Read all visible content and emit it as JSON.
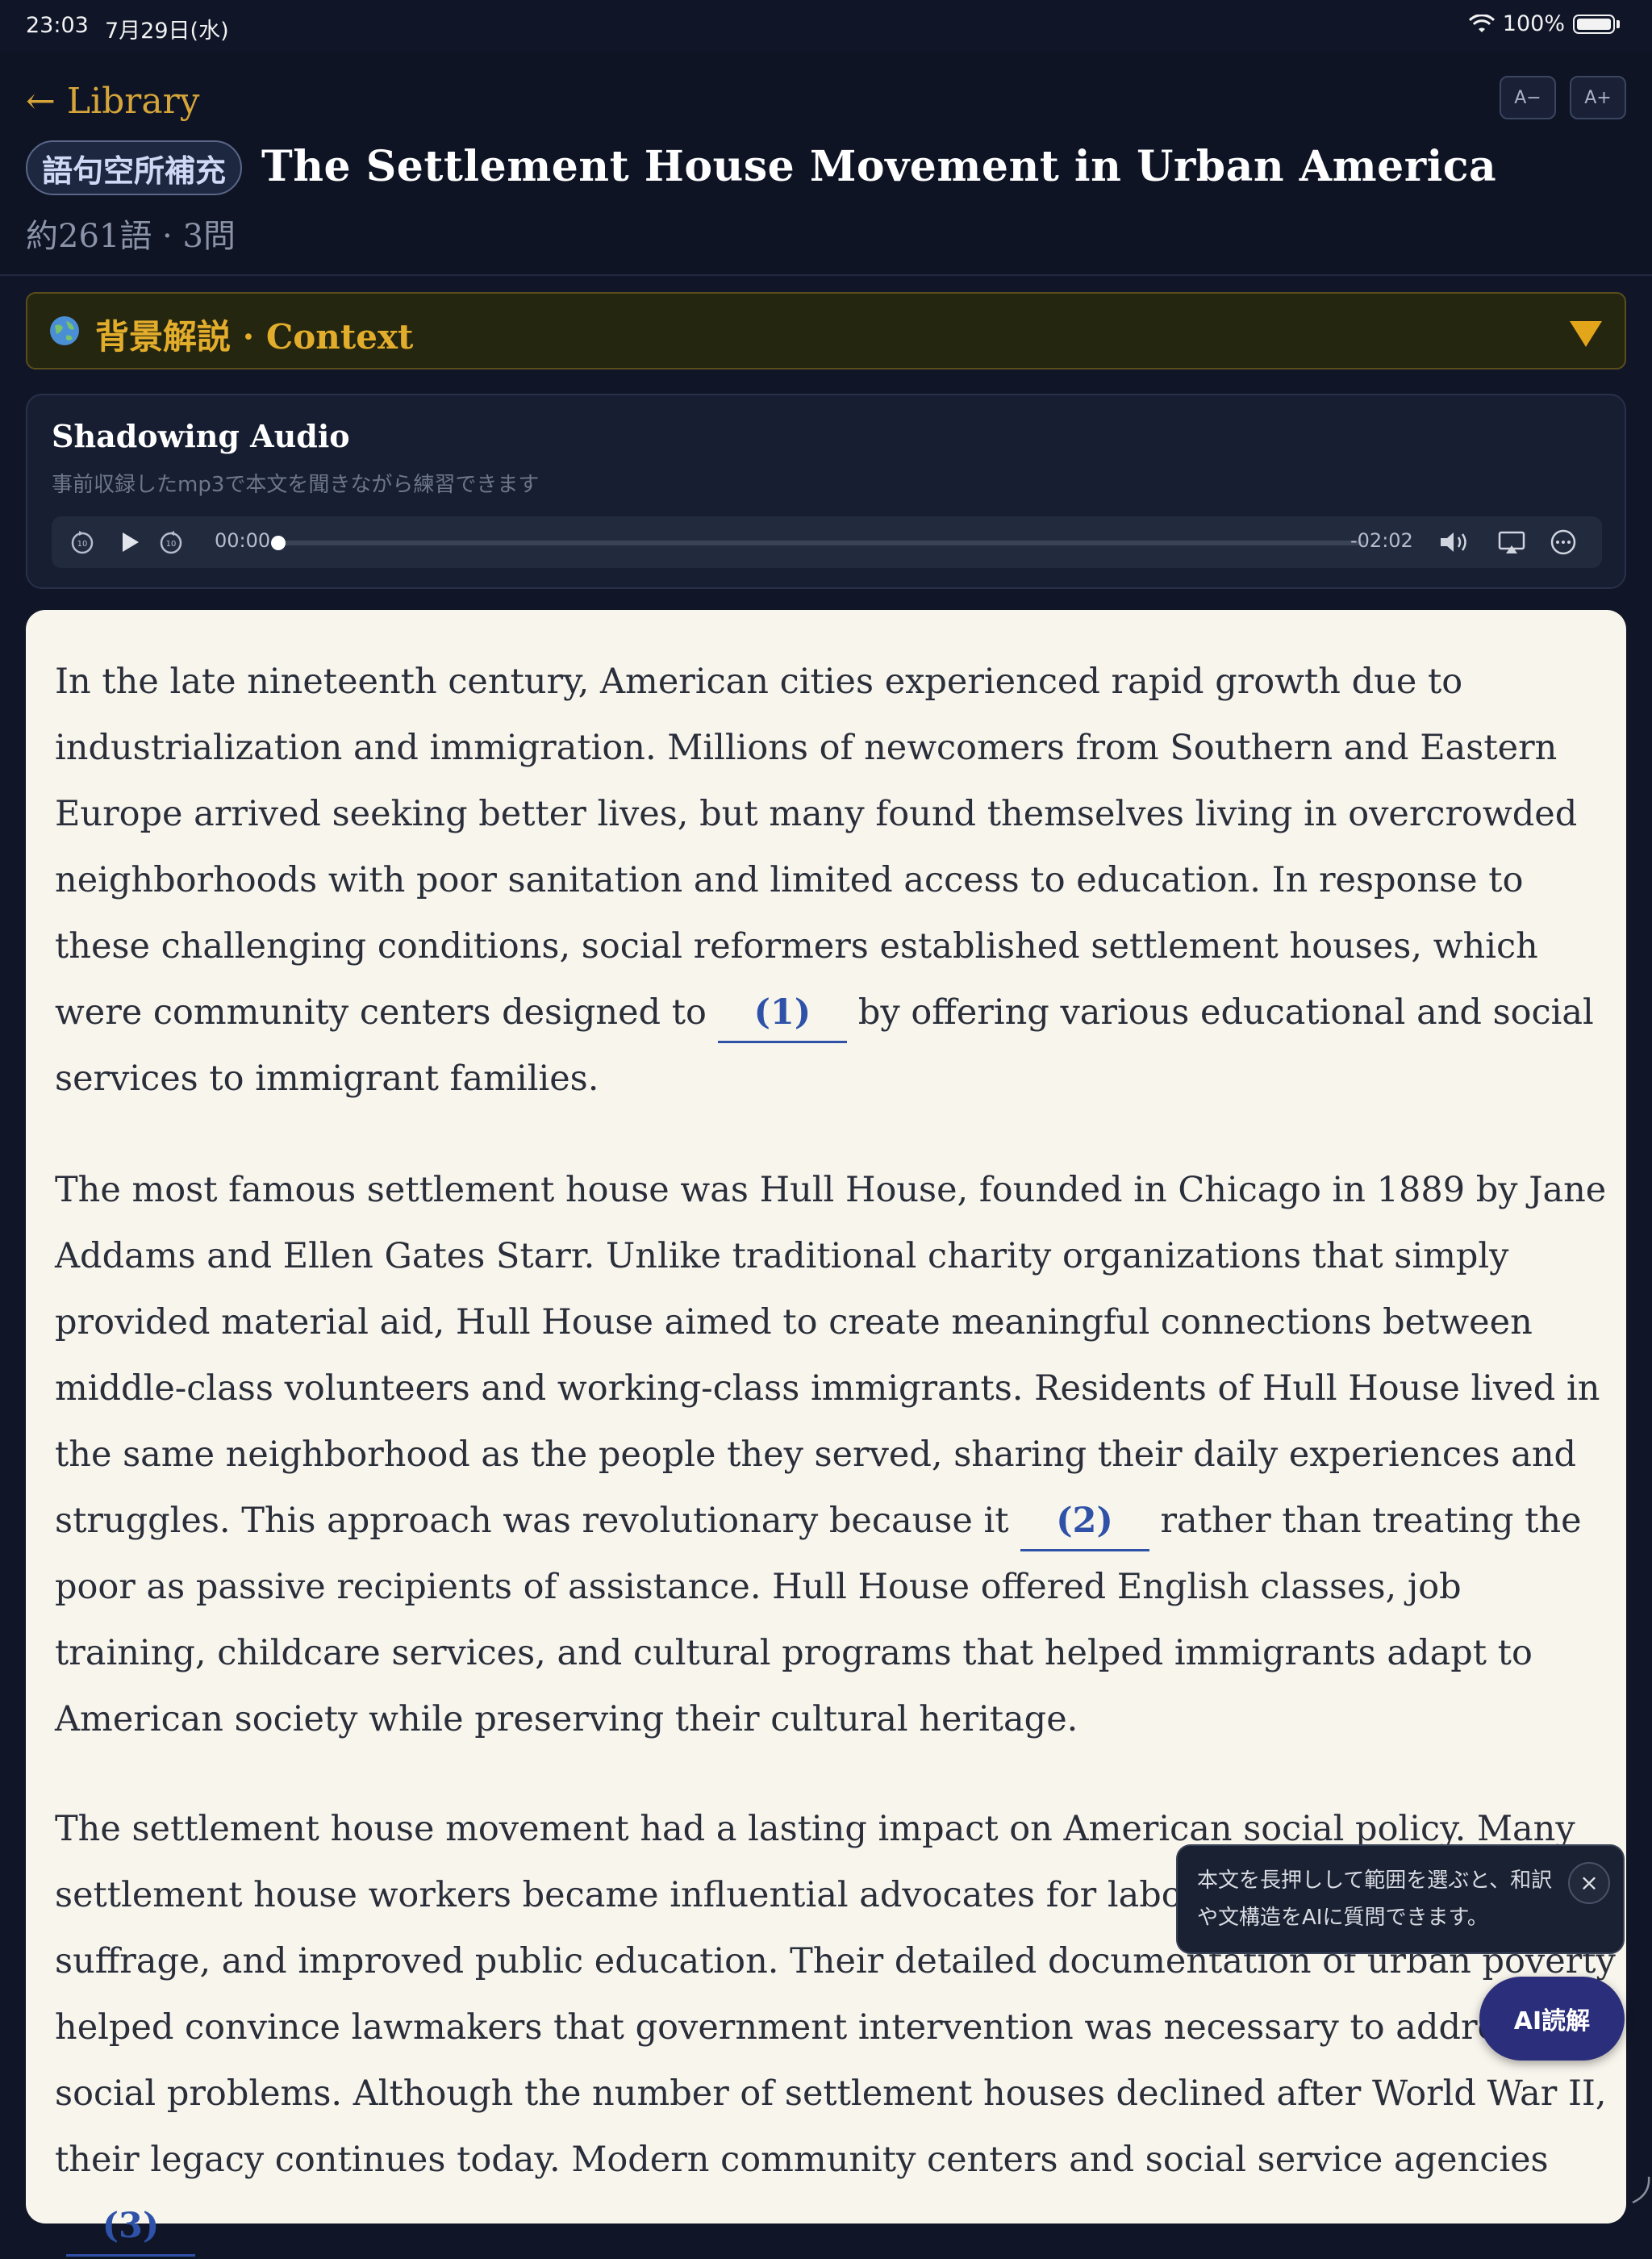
{
  "status": {
    "time": "23:03",
    "date": "7月29日(水)",
    "battery": "100%"
  },
  "header": {
    "back_label": "← Library",
    "font_decrease": "A−",
    "font_increase": "A+",
    "tag": "語句空所補充",
    "title": "The Settlement House Movement in Urban America",
    "meta": "約261語 · 3問"
  },
  "context": {
    "label": "背景解説 · Context"
  },
  "audio": {
    "title": "Shadowing Audio",
    "subtitle": "事前収録したmp3で本文を聞きながら練習できます",
    "current_time": "00:00",
    "remaining_time": "-02:02",
    "progress": 0
  },
  "passage": {
    "p1_a": "In the late nineteenth century, American cities experienced rapid growth due to industrialization and immigration. Millions of newcomers from Southern and Eastern Europe arrived seeking better lives, but many found themselves living in overcrowded neighborhoods with poor sanitation and limited access to education. In response to these challenging conditions, social reformers established settlement houses, which were community centers designed to",
    "blank1": "(1)",
    "p1_b": "by offering various educational and social services to immigrant families.",
    "p2_a": "The most famous settlement house was Hull House, founded in Chicago in 1889 by Jane Addams and Ellen Gates Starr. Unlike traditional charity organizations that simply provided material aid, Hull House aimed to create meaningful connections between middle-class volunteers and working-class immigrants. Residents of Hull House lived in the same neighborhood as the people they served, sharing their daily experiences and struggles. This approach was revolutionary because it",
    "blank2": "(2)",
    "p2_b": "rather than treating the poor as passive recipients of assistance. Hull House offered English classes, job training, childcare services, and cultural programs that helped immigrants adapt to American society while preserving their cultural heritage.",
    "p3_a": "The settlement house movement had a lasting impact on American social policy. Many settlement house workers became influential advocates for labor reform, women's suffrage, and improved public education. Their detailed documentation of urban poverty helped convince lawmakers that government intervention was necessary to address social problems. Although the number of settlement houses declined after World War II, their legacy continues today. Modern community centers and social service agencies",
    "blank3": "(3)"
  },
  "tooltip": {
    "text": "本文を長押しして範囲を選ぶと、和訳や文構造をAIに質問できます。",
    "close": "×"
  },
  "ai_button": {
    "label": "AI読解"
  },
  "colors": {
    "accent": "#d6a53a",
    "blank": "#2f52a8",
    "paper": "#f7f5ec",
    "background": "#101628"
  }
}
